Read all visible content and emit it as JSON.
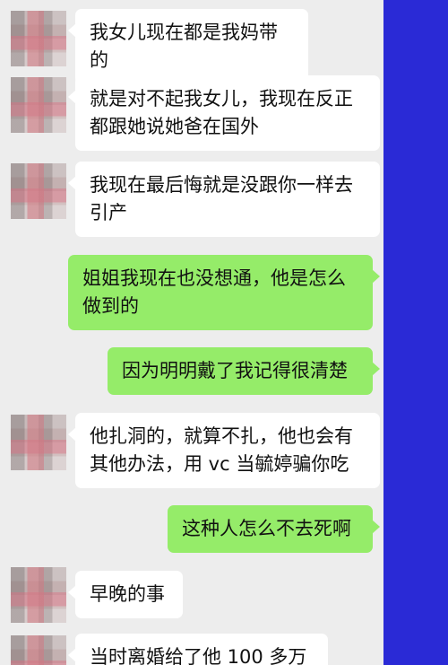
{
  "messages": [
    {
      "side": "in",
      "text": "我女儿现在都是我妈带的"
    },
    {
      "side": "in",
      "text": "就是对不起我女儿，我现在反正都跟她说她爸在国外"
    },
    {
      "side": "in",
      "text": "我现在最后悔就是没跟你一样去引产"
    },
    {
      "side": "out",
      "text": "姐姐我现在也没想通，他是怎么做到的"
    },
    {
      "side": "out",
      "text": "因为明明戴了我记得很清楚"
    },
    {
      "side": "in",
      "text": "他扎洞的，就算不扎，他也会有其他办法，用 vc 当毓婷骗你吃"
    },
    {
      "side": "out",
      "text": "这种人怎么不去死啊"
    },
    {
      "side": "in",
      "text": "早晚的事"
    },
    {
      "side": "in",
      "text": "当时离婚给了他 100 多万"
    }
  ],
  "colors": {
    "incoming_bubble": "#ffffff",
    "outgoing_bubble": "#95ec69",
    "chat_bg": "#ededed",
    "side_bar": "#2a2ad6"
  }
}
